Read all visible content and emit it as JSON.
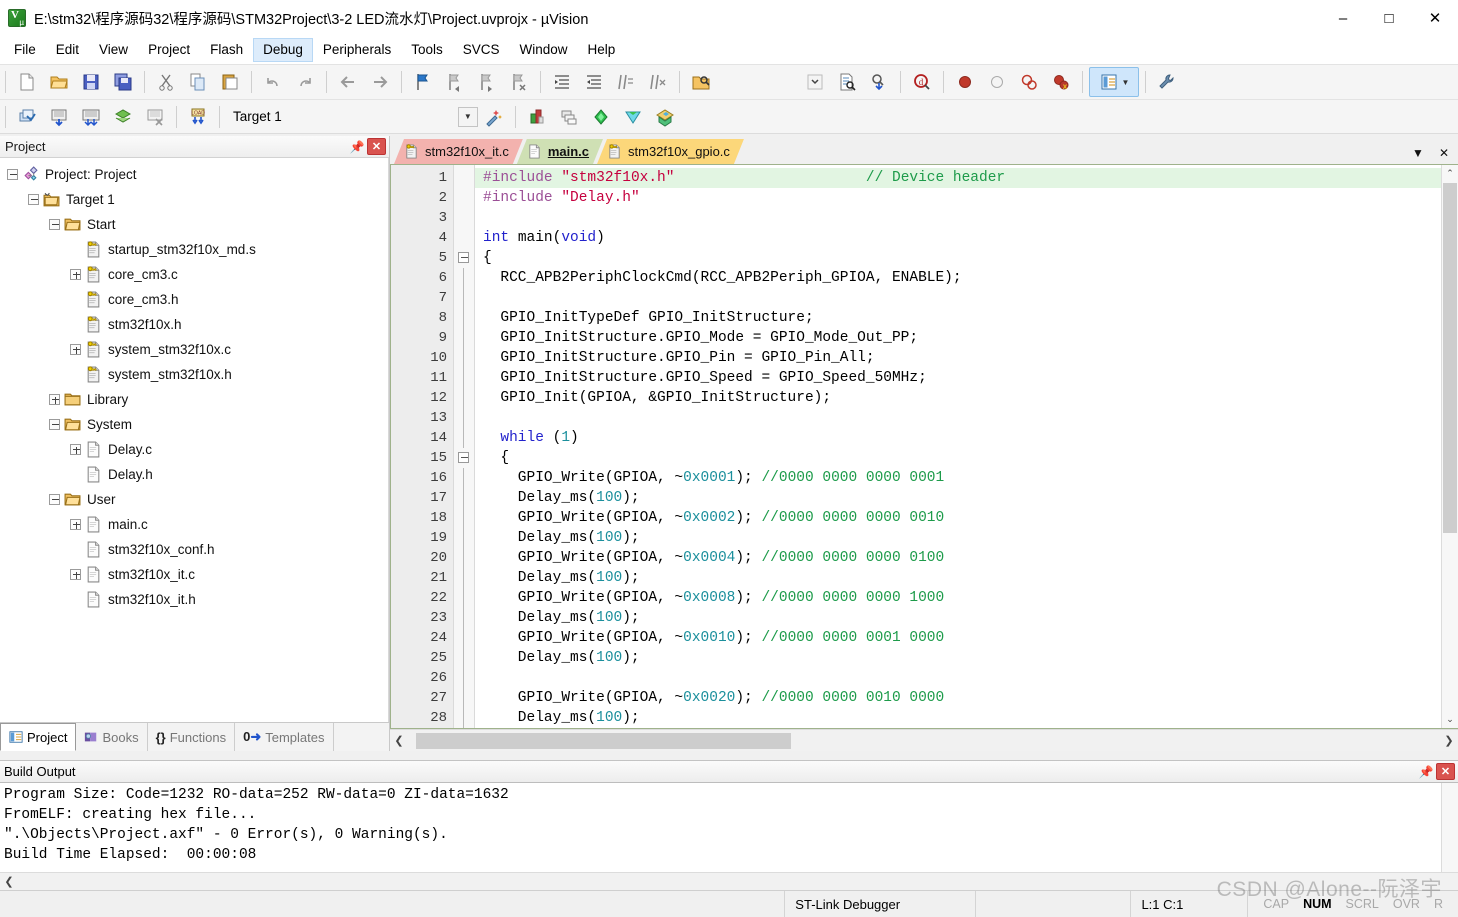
{
  "window": {
    "title": "E:\\stm32\\程序源码32\\程序源码\\STM32Project\\3-2 LED流水灯\\Project.uvprojx - µVision",
    "icon": "uvision-logo-icon",
    "minimize": "–",
    "maximize": "□",
    "close": "✕"
  },
  "menubar": {
    "items": [
      {
        "label": "File",
        "active": false
      },
      {
        "label": "Edit",
        "active": false
      },
      {
        "label": "View",
        "active": false
      },
      {
        "label": "Project",
        "active": false
      },
      {
        "label": "Flash",
        "active": false
      },
      {
        "label": "Debug",
        "active": true
      },
      {
        "label": "Peripherals",
        "active": false
      },
      {
        "label": "Tools",
        "active": false
      },
      {
        "label": "SVCS",
        "active": false
      },
      {
        "label": "Window",
        "active": false
      },
      {
        "label": "Help",
        "active": false
      }
    ]
  },
  "toolbar_row1": {
    "buttons": [
      {
        "name": "new-file-icon",
        "sep_after": false
      },
      {
        "name": "open-file-icon",
        "sep_after": false
      },
      {
        "name": "save-icon",
        "sep_after": false
      },
      {
        "name": "save-all-icon",
        "sep_after": true
      },
      {
        "name": "cut-icon",
        "sep_after": false
      },
      {
        "name": "copy-icon",
        "sep_after": false
      },
      {
        "name": "paste-icon",
        "sep_after": true
      },
      {
        "name": "undo-icon",
        "sep_after": false
      },
      {
        "name": "redo-icon",
        "sep_after": true
      },
      {
        "name": "navigate-back-icon",
        "sep_after": false
      },
      {
        "name": "navigate-forward-icon",
        "sep_after": true
      },
      {
        "name": "bookmark-toggle-icon",
        "sep_after": false
      },
      {
        "name": "bookmark-prev-icon",
        "sep_after": false
      },
      {
        "name": "bookmark-next-icon",
        "sep_after": false
      },
      {
        "name": "bookmark-clear-icon",
        "sep_after": true
      },
      {
        "name": "indent-increase-icon",
        "sep_after": false
      },
      {
        "name": "indent-decrease-icon",
        "sep_after": false
      },
      {
        "name": "comment-lines-icon",
        "sep_after": false
      },
      {
        "name": "uncomment-lines-icon",
        "sep_after": true
      },
      {
        "name": "find-in-files-icon",
        "sep_after": false
      }
    ],
    "right_buttons": [
      {
        "name": "search-combo-dropdown-icon"
      },
      {
        "name": "find-document-icon"
      },
      {
        "name": "incremental-find-icon"
      },
      {
        "name": "find-in-project-icon"
      },
      {
        "name": "breakpoint-insert-icon"
      },
      {
        "name": "breakpoint-disable-icon"
      },
      {
        "name": "breakpoint-kill-all-icon"
      },
      {
        "name": "breakpoint-disable-all-icon"
      },
      {
        "name": "manage-windows-icon",
        "selected": true
      },
      {
        "name": "configure-toolbar-icon"
      }
    ]
  },
  "toolbar_row2": {
    "buttons": [
      {
        "name": "translate-file-icon"
      },
      {
        "name": "build-target-icon"
      },
      {
        "name": "rebuild-all-icon"
      },
      {
        "name": "batch-build-icon"
      },
      {
        "name": "stop-build-icon"
      },
      {
        "name": "download-to-flash-icon"
      }
    ],
    "target_value": "Target 1",
    "right_buttons": [
      {
        "name": "target-options-wizard-icon"
      },
      {
        "name": "manage-project-items-icon"
      },
      {
        "name": "manage-multi-project-icon"
      },
      {
        "name": "pack-installer-icon"
      },
      {
        "name": "run-time-environment-icon"
      },
      {
        "name": "select-software-packs-icon"
      }
    ]
  },
  "project_panel": {
    "title": "Project",
    "pin_icon": "pin-icon",
    "close_icon": "close-icon",
    "tree": [
      {
        "depth": 0,
        "toggle": "minus",
        "icon": "project-icon",
        "label": "Project: Project"
      },
      {
        "depth": 1,
        "toggle": "minus",
        "icon": "target-icon",
        "label": "Target 1"
      },
      {
        "depth": 2,
        "toggle": "minus",
        "icon": "folder-icon",
        "label": "Start"
      },
      {
        "depth": 3,
        "toggle": "none",
        "icon": "asm-file-icon",
        "label": "startup_stm32f10x_md.s"
      },
      {
        "depth": 3,
        "toggle": "plus",
        "icon": "c-file-icon",
        "label": "core_cm3.c"
      },
      {
        "depth": 3,
        "toggle": "none",
        "icon": "h-file-icon",
        "label": "core_cm3.h"
      },
      {
        "depth": 3,
        "toggle": "none",
        "icon": "h-file-icon",
        "label": "stm32f10x.h"
      },
      {
        "depth": 3,
        "toggle": "plus",
        "icon": "c-file-icon",
        "label": "system_stm32f10x.c"
      },
      {
        "depth": 3,
        "toggle": "none",
        "icon": "h-file-icon",
        "label": "system_stm32f10x.h"
      },
      {
        "depth": 2,
        "toggle": "plus",
        "icon": "folder-closed-icon",
        "label": "Library"
      },
      {
        "depth": 2,
        "toggle": "minus",
        "icon": "folder-icon",
        "label": "System"
      },
      {
        "depth": 3,
        "toggle": "plus",
        "icon": "doc-file-icon",
        "label": "Delay.c"
      },
      {
        "depth": 3,
        "toggle": "none",
        "icon": "doc-file-icon",
        "label": "Delay.h"
      },
      {
        "depth": 2,
        "toggle": "minus",
        "icon": "folder-icon",
        "label": "User"
      },
      {
        "depth": 3,
        "toggle": "plus",
        "icon": "doc-file-icon",
        "label": "main.c"
      },
      {
        "depth": 3,
        "toggle": "none",
        "icon": "doc-file-icon",
        "label": "stm32f10x_conf.h"
      },
      {
        "depth": 3,
        "toggle": "plus",
        "icon": "doc-file-icon",
        "label": "stm32f10x_it.c"
      },
      {
        "depth": 3,
        "toggle": "none",
        "icon": "doc-file-icon",
        "label": "stm32f10x_it.h"
      }
    ],
    "tabs": [
      {
        "label": "Project",
        "icon": "project-tab-icon",
        "active": true
      },
      {
        "label": "Books",
        "icon": "books-tab-icon",
        "active": false
      },
      {
        "label": "Functions",
        "icon": "functions-tab-icon",
        "active": false
      },
      {
        "label": "Templates",
        "icon": "templates-tab-icon",
        "active": false
      }
    ]
  },
  "editor": {
    "tabs": [
      {
        "label": "stm32f10x_it.c",
        "color": "pink",
        "icon": "c-file-icon",
        "active": false
      },
      {
        "label": "main.c",
        "color": "green",
        "icon": "doc-file-icon",
        "active": true
      },
      {
        "label": "stm32f10x_gpio.c",
        "color": "yellow",
        "icon": "key-file-icon",
        "active": false
      }
    ],
    "tabbar_dropdown": "▼",
    "tabbar_close": "✕",
    "scroll_up": "⌃",
    "scroll_down": "⌄",
    "hscroll_left": "❮",
    "hscroll_right": "❯",
    "lines": [
      {
        "n": 1,
        "fold": "none",
        "cur": true,
        "tokens": [
          {
            "t": "#include ",
            "c": "pre"
          },
          {
            "t": "\"stm32f10x.h\"",
            "c": "str"
          },
          {
            "t": "                      ",
            "c": ""
          },
          {
            "t": "// Device header",
            "c": "cmt"
          }
        ]
      },
      {
        "n": 2,
        "fold": "none",
        "tokens": [
          {
            "t": "#include ",
            "c": "pre"
          },
          {
            "t": "\"Delay.h\"",
            "c": "str"
          }
        ]
      },
      {
        "n": 3,
        "fold": "none",
        "tokens": []
      },
      {
        "n": 4,
        "fold": "none",
        "tokens": [
          {
            "t": "int ",
            "c": "kw"
          },
          {
            "t": "main(",
            "c": ""
          },
          {
            "t": "void",
            "c": "kw"
          },
          {
            "t": ")",
            "c": ""
          }
        ]
      },
      {
        "n": 5,
        "fold": "box",
        "tokens": [
          {
            "t": "{",
            "c": ""
          }
        ]
      },
      {
        "n": 6,
        "fold": "line",
        "tokens": [
          {
            "t": "  RCC_APB2PeriphClockCmd(RCC_APB2Periph_GPIOA, ENABLE);",
            "c": ""
          }
        ]
      },
      {
        "n": 7,
        "fold": "line",
        "tokens": []
      },
      {
        "n": 8,
        "fold": "line",
        "tokens": [
          {
            "t": "  GPIO_InitTypeDef GPIO_InitStructure;",
            "c": ""
          }
        ]
      },
      {
        "n": 9,
        "fold": "line",
        "tokens": [
          {
            "t": "  GPIO_InitStructure.GPIO_Mode = GPIO_Mode_Out_PP;",
            "c": ""
          }
        ]
      },
      {
        "n": 10,
        "fold": "line",
        "tokens": [
          {
            "t": "  GPIO_InitStructure.GPIO_Pin = GPIO_Pin_All;",
            "c": ""
          }
        ]
      },
      {
        "n": 11,
        "fold": "line",
        "tokens": [
          {
            "t": "  GPIO_InitStructure.GPIO_Speed = GPIO_Speed_50MHz;",
            "c": ""
          }
        ]
      },
      {
        "n": 12,
        "fold": "line",
        "tokens": [
          {
            "t": "  GPIO_Init(GPIOA, &GPIO_InitStructure);",
            "c": ""
          }
        ]
      },
      {
        "n": 13,
        "fold": "line",
        "tokens": []
      },
      {
        "n": 14,
        "fold": "line",
        "tokens": [
          {
            "t": "  ",
            "c": ""
          },
          {
            "t": "while",
            "c": "kw"
          },
          {
            "t": " (",
            "c": ""
          },
          {
            "t": "1",
            "c": "num"
          },
          {
            "t": ")",
            "c": ""
          }
        ]
      },
      {
        "n": 15,
        "fold": "box",
        "tokens": [
          {
            "t": "  {",
            "c": ""
          }
        ]
      },
      {
        "n": 16,
        "fold": "line",
        "tokens": [
          {
            "t": "    GPIO_Write(GPIOA, ~",
            "c": ""
          },
          {
            "t": "0x0001",
            "c": "num"
          },
          {
            "t": "); ",
            "c": ""
          },
          {
            "t": "//0000 0000 0000 0001",
            "c": "cmt"
          }
        ]
      },
      {
        "n": 17,
        "fold": "line",
        "tokens": [
          {
            "t": "    Delay_ms(",
            "c": ""
          },
          {
            "t": "100",
            "c": "num"
          },
          {
            "t": ");",
            "c": ""
          }
        ]
      },
      {
        "n": 18,
        "fold": "line",
        "tokens": [
          {
            "t": "    GPIO_Write(GPIOA, ~",
            "c": ""
          },
          {
            "t": "0x0002",
            "c": "num"
          },
          {
            "t": "); ",
            "c": ""
          },
          {
            "t": "//0000 0000 0000 0010",
            "c": "cmt"
          }
        ]
      },
      {
        "n": 19,
        "fold": "line",
        "tokens": [
          {
            "t": "    Delay_ms(",
            "c": ""
          },
          {
            "t": "100",
            "c": "num"
          },
          {
            "t": ");",
            "c": ""
          }
        ]
      },
      {
        "n": 20,
        "fold": "line",
        "tokens": [
          {
            "t": "    GPIO_Write(GPIOA, ~",
            "c": ""
          },
          {
            "t": "0x0004",
            "c": "num"
          },
          {
            "t": "); ",
            "c": ""
          },
          {
            "t": "//0000 0000 0000 0100",
            "c": "cmt"
          }
        ]
      },
      {
        "n": 21,
        "fold": "line",
        "tokens": [
          {
            "t": "    Delay_ms(",
            "c": ""
          },
          {
            "t": "100",
            "c": "num"
          },
          {
            "t": ");",
            "c": ""
          }
        ]
      },
      {
        "n": 22,
        "fold": "line",
        "tokens": [
          {
            "t": "    GPIO_Write(GPIOA, ~",
            "c": ""
          },
          {
            "t": "0x0008",
            "c": "num"
          },
          {
            "t": "); ",
            "c": ""
          },
          {
            "t": "//0000 0000 0000 1000",
            "c": "cmt"
          }
        ]
      },
      {
        "n": 23,
        "fold": "line",
        "tokens": [
          {
            "t": "    Delay_ms(",
            "c": ""
          },
          {
            "t": "100",
            "c": "num"
          },
          {
            "t": ");",
            "c": ""
          }
        ]
      },
      {
        "n": 24,
        "fold": "line",
        "tokens": [
          {
            "t": "    GPIO_Write(GPIOA, ~",
            "c": ""
          },
          {
            "t": "0x0010",
            "c": "num"
          },
          {
            "t": "); ",
            "c": ""
          },
          {
            "t": "//0000 0000 0001 0000",
            "c": "cmt"
          }
        ]
      },
      {
        "n": 25,
        "fold": "line",
        "tokens": [
          {
            "t": "    Delay_ms(",
            "c": ""
          },
          {
            "t": "100",
            "c": "num"
          },
          {
            "t": ");",
            "c": ""
          }
        ]
      },
      {
        "n": 26,
        "fold": "line",
        "tokens": []
      },
      {
        "n": 27,
        "fold": "line",
        "tokens": [
          {
            "t": "    GPIO_Write(GPIOA, ~",
            "c": ""
          },
          {
            "t": "0x0020",
            "c": "num"
          },
          {
            "t": "); ",
            "c": ""
          },
          {
            "t": "//0000 0000 0010 0000",
            "c": "cmt"
          }
        ]
      },
      {
        "n": 28,
        "fold": "line",
        "tokens": [
          {
            "t": "    Delay_ms(",
            "c": ""
          },
          {
            "t": "100",
            "c": "num"
          },
          {
            "t": ");",
            "c": ""
          }
        ]
      }
    ]
  },
  "build_output": {
    "title": "Build Output",
    "pin_icon": "pin-icon",
    "close_icon": "close-icon",
    "lines": [
      "Program Size: Code=1232 RO-data=252 RW-data=0 ZI-data=1632",
      "FromELF: creating hex file...",
      "\".\\Objects\\Project.axf\" - 0 Error(s), 0 Warning(s).",
      "Build Time Elapsed:  00:00:08"
    ],
    "hscroll_left": "❮"
  },
  "statusbar": {
    "debugger": "ST-Link Debugger",
    "cursor": "L:1 C:1",
    "indicators": [
      {
        "label": "CAP",
        "on": false
      },
      {
        "label": "NUM",
        "on": true
      },
      {
        "label": "SCRL",
        "on": false
      },
      {
        "label": "OVR",
        "on": false
      },
      {
        "label": "R",
        "on": false
      }
    ]
  },
  "watermark": "CSDN @Alone--阮泽宇",
  "colors": {
    "tab_pink": "#f3b2ae",
    "tab_green": "#cfe0b4",
    "tab_yellow": "#fcd77a",
    "menu_active": "#ddecfb",
    "current_line": "#e2f5e2",
    "comment": "#1d9b4a",
    "string": "#c5003e",
    "keyword": "#2222cc",
    "number": "#1b8f9c",
    "preproc": "#9b4f96"
  }
}
